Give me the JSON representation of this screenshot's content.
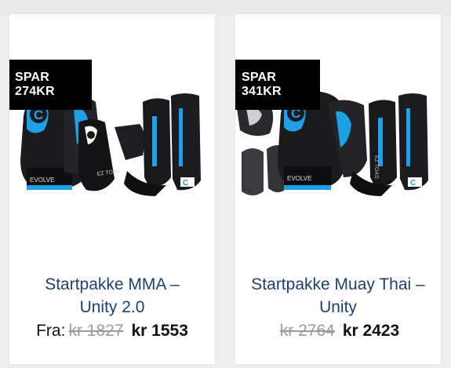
{
  "products": [
    {
      "badge": "SPAR 274KR",
      "title_line1": "Startpakke MMA –",
      "title_line2": "Unity 2.0",
      "price_prefix": "Fra:",
      "old_price": "kr 1827",
      "new_price": "kr 1553",
      "image_brand": "EVOLVE",
      "image_text": "EZ TOAS"
    },
    {
      "badge": "SPAR 341KR",
      "title_line1": "Startpakke Muay Thai –",
      "title_line2": "Unity",
      "price_prefix": "",
      "old_price": "kr 2764",
      "new_price": "kr 2423",
      "image_brand": "EVOLVE",
      "image_text": "EZ TOAS"
    }
  ],
  "colors": {
    "title": "#1c4070",
    "badge_bg": "#000000",
    "accent_blue": "#1ea0e6"
  }
}
